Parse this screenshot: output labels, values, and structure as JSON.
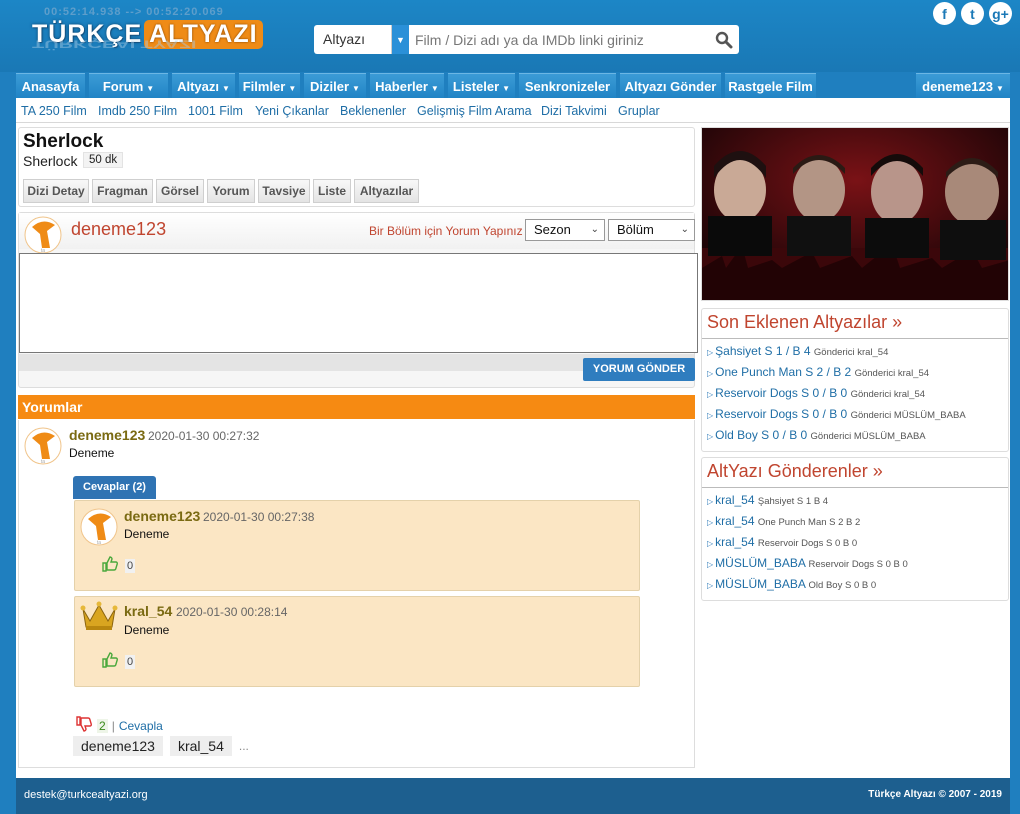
{
  "logo": {
    "timecode": "00:52:14.938 --> 00:52:20.069",
    "word1": "TÜRKÇE",
    "word2": "ALTYAZI"
  },
  "search": {
    "type": "Altyazı",
    "placeholder": "Film / Dizi adı ya da IMDb linki giriniz"
  },
  "social": [
    "f",
    "t",
    "g+"
  ],
  "nav": [
    "Anasayfa",
    "Forum",
    "Altyazı",
    "Filmler",
    "Diziler",
    "Haberler",
    "Listeler",
    "Senkronizeler",
    "Altyazı Gönder",
    "Rastgele Film"
  ],
  "user_menu": "deneme123",
  "subnav": [
    "TA 250 Film",
    "Imdb 250 Film",
    "1001 Film",
    "Yeni Çıkanlar",
    "Beklenenler",
    "Gelişmiş Film Arama",
    "Dizi Takvimi",
    "Gruplar"
  ],
  "show": {
    "title": "Sherlock",
    "subtitle": "Sherlock",
    "duration": "50 dk"
  },
  "tabs": [
    "Dizi Detay",
    "Fragman",
    "Görsel",
    "Yorum",
    "Tavsiye",
    "Liste",
    "Altyazılar"
  ],
  "comment_form": {
    "user": "deneme123",
    "hint": "Bir Bölüm için Yorum Yapınız",
    "season": "Sezon",
    "episode": "Bölüm",
    "submit": "YORUM GÖNDER"
  },
  "comments_header": "Yorumlar",
  "comment": {
    "user": "deneme123",
    "date": "2020-01-30 00:27:32",
    "text": "Deneme",
    "replies_button": "Cevaplar (2)",
    "replies": [
      {
        "user": "deneme123",
        "date": "2020-01-30 00:27:38",
        "text": "Deneme",
        "likes": "0"
      },
      {
        "user": "kral_54",
        "date": "2020-01-30 00:28:14",
        "text": "Deneme",
        "likes": "0"
      }
    ],
    "dislikes": "2",
    "reply_link": "Cevapla",
    "participants": [
      "deneme123",
      "kral_54"
    ],
    "more": "..."
  },
  "recent": {
    "title": "Son Eklenen Altyazılar",
    "items": [
      {
        "title": "Şahsiyet S 1 / B 4",
        "meta": "Gönderici kral_54"
      },
      {
        "title": "One Punch Man S 2 / B 2",
        "meta": "Gönderici kral_54"
      },
      {
        "title": "Reservoir Dogs S 0 / B 0",
        "meta": "Gönderici kral_54"
      },
      {
        "title": "Reservoir Dogs S 0 / B 0",
        "meta": "Gönderici MÜSLÜM_BABA"
      },
      {
        "title": "Old Boy S 0 / B 0",
        "meta": "Gönderici MÜSLÜM_BABA"
      }
    ]
  },
  "senders": {
    "title": "AltYazı Gönderenler",
    "items": [
      {
        "user": "kral_54",
        "meta": "Şahsiyet S 1 B 4"
      },
      {
        "user": "kral_54",
        "meta": "One Punch Man S 2 B 2"
      },
      {
        "user": "kral_54",
        "meta": "Reservoir Dogs S 0 B 0"
      },
      {
        "user": "MÜSLÜM_BABA",
        "meta": "Reservoir Dogs S 0 B 0"
      },
      {
        "user": "MÜSLÜM_BABA",
        "meta": "Old Boy S 0 B 0"
      }
    ]
  },
  "footer": {
    "email": "destek@turkcealtyazi.org",
    "copyright": "Türkçe Altyazı © 2007 - 2019"
  },
  "colors": {
    "brand_blue": "#1b7fbf",
    "accent_orange": "#f68a12",
    "heading_red": "#c0452f",
    "link": "#1f6ea6"
  },
  "icons": [
    "search-icon",
    "facebook-icon",
    "twitter-icon",
    "google-plus-icon",
    "thumbs-up-icon",
    "thumbs-down-icon",
    "crown-icon"
  ]
}
